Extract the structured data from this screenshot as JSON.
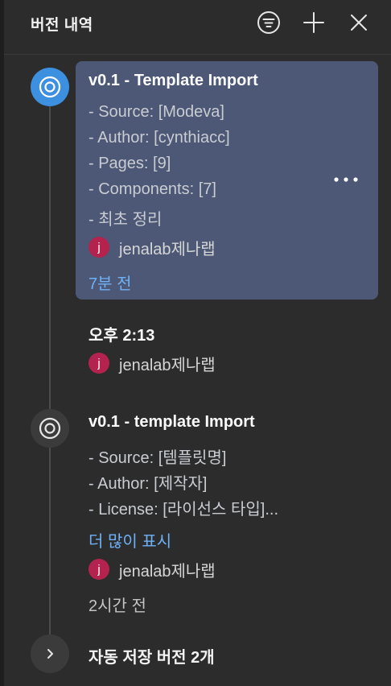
{
  "header": {
    "title": "버전 내역",
    "icons": [
      "filter-icon",
      "add-icon",
      "close-icon"
    ]
  },
  "versions": [
    {
      "title": "v0.1 - Template Import",
      "lines": [
        "- Source: [Modeva]",
        "- Author: [cynthiacc]",
        "- Pages: [9]",
        "- Components: [7]",
        "- 최초 정리"
      ],
      "user": {
        "initial": "j",
        "name": "jenalab제나랩"
      },
      "time": "7분 전",
      "more_icon": "more-horizontal-icon"
    },
    {
      "title": "오후 2:13",
      "user": {
        "initial": "j",
        "name": "jenalab제나랩"
      }
    },
    {
      "title": "v0.1 - template Import",
      "lines": [
        "- Source: [템플릿명]",
        "- Author: [제작자]",
        "- License: [라이선스 타입]..."
      ],
      "show_more": "더 많이 표시",
      "user": {
        "initial": "j",
        "name": "jenalab제나랩"
      },
      "time": "2시간 전"
    }
  ],
  "autosave": {
    "label": "자동 저장 버전 2개",
    "icon": "chevron-right-icon"
  },
  "colors": {
    "background": "#2c2c2c",
    "selected_card": "#4c5875",
    "active_node": "#3d8fe0",
    "link": "#6fb1f7",
    "avatar": "#b3234e"
  }
}
